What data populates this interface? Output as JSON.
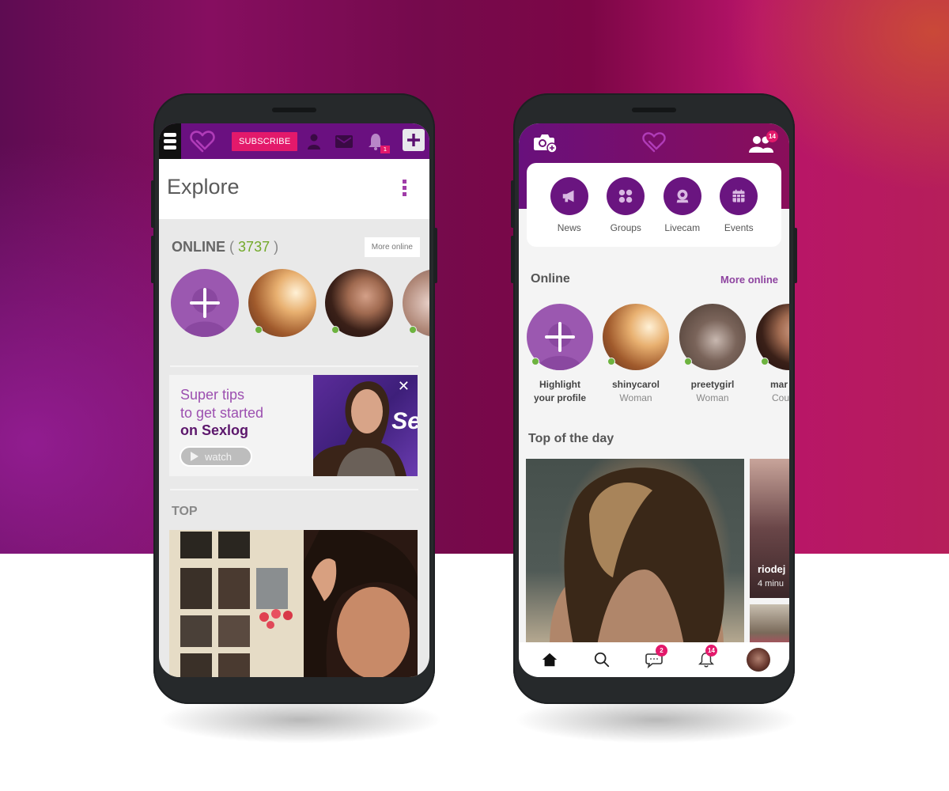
{
  "left_phone": {
    "topbar": {
      "menu_icon": "hamburger-icon",
      "logo_icon": "heart-logo-icon",
      "subscribe_label": "SUBSCRIBE",
      "profile_icon": "person-icon",
      "messages_icon": "envelope-icon",
      "notifications_icon": "bell-icon",
      "notifications_badge": "1",
      "add_icon": "plus-icon"
    },
    "header": {
      "title": "Explore",
      "menu_icon": "kebab-menu-icon"
    },
    "online": {
      "label": "ONLINE",
      "count_open": "(",
      "count": "3737",
      "count_close": ")",
      "more_label": "More online",
      "avatars": [
        {
          "type": "add",
          "label": "add-profile"
        },
        {
          "type": "photo",
          "online": true
        },
        {
          "type": "photo",
          "online": true
        },
        {
          "type": "photo",
          "online": true
        }
      ]
    },
    "promo": {
      "line1": "Super tips",
      "line2": "to get started",
      "line3": "on Sexlog",
      "watch_label": "watch",
      "close_glyph": "✕",
      "video_text": "Se"
    },
    "top": {
      "label": "TOP"
    }
  },
  "right_phone": {
    "topbar": {
      "camera_icon": "camera-plus-icon",
      "logo_icon": "heart-logo-icon",
      "people_icon": "people-icon",
      "people_badge": "14"
    },
    "quick_links": [
      {
        "label": "News",
        "icon": "megaphone-icon"
      },
      {
        "label": "Groups",
        "icon": "groups-icon"
      },
      {
        "label": "Livecam",
        "icon": "webcam-icon"
      },
      {
        "label": "Events",
        "icon": "calendar-icon"
      }
    ],
    "online": {
      "title": "Online",
      "more_label": "More online",
      "users": [
        {
          "name": "Highlight your profile",
          "sub": "",
          "type": "add"
        },
        {
          "name": "shinycarol",
          "sub": "Woman",
          "type": "photo"
        },
        {
          "name": "preetygirl",
          "sub": "Woman",
          "type": "photo"
        },
        {
          "name": "mar",
          "sub": "Cou",
          "type": "photo"
        }
      ]
    },
    "top_of_day": {
      "title": "Top of the day",
      "side_name": "riodej",
      "side_time": "4 minu"
    },
    "bottom_nav": {
      "home_icon": "home-icon",
      "search_icon": "search-icon",
      "chat_icon": "chat-icon",
      "chat_badge": "2",
      "bell_icon": "bell-icon",
      "bell_badge": "14",
      "avatar_icon": "user-avatar"
    }
  },
  "colors": {
    "brand_purple": "#6a1080",
    "accent_pink": "#e3196b",
    "online_green": "#6db33f",
    "count_green": "#73a92a",
    "link_purple": "#8e44a0"
  }
}
